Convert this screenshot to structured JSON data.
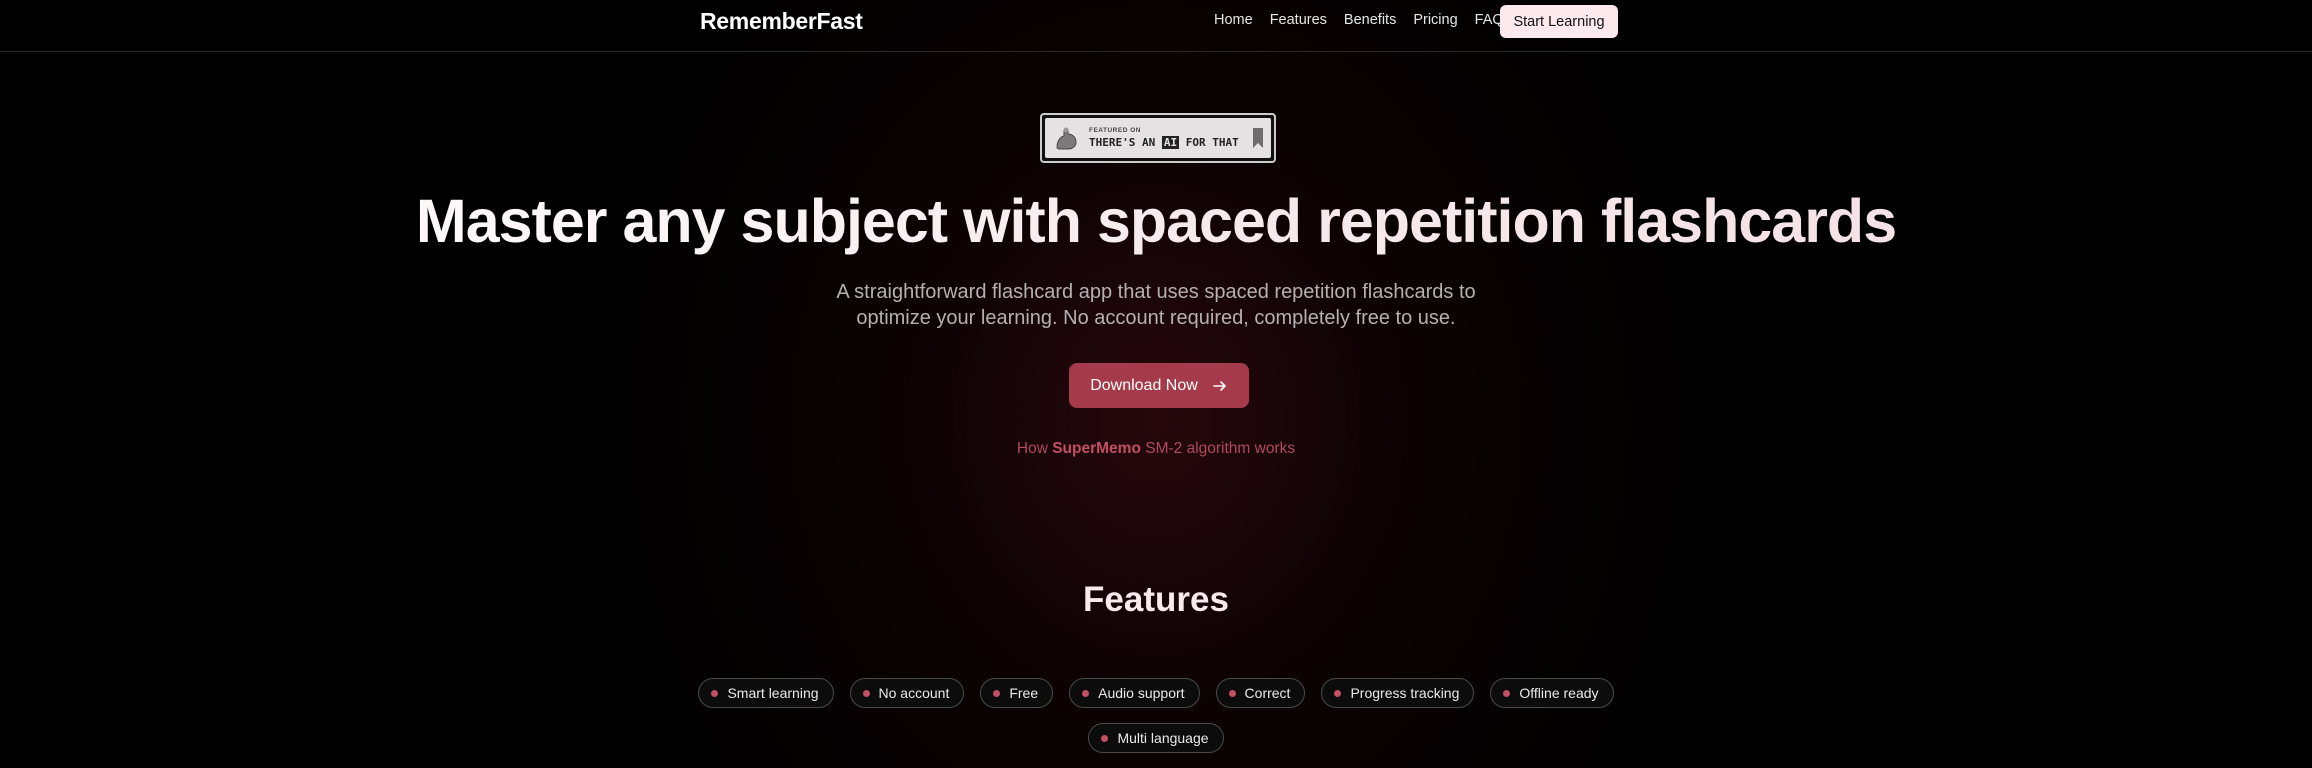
{
  "nav": {
    "brand": "RememberFast",
    "links": [
      "Home",
      "Features",
      "Benefits",
      "Pricing",
      "FAQ"
    ],
    "cta": "Start Learning"
  },
  "badge": {
    "small": "FEATURED ON",
    "big_pre": "THERE'S AN",
    "big_ai": "AI",
    "big_post": "FOR THAT"
  },
  "hero": {
    "title": "Master any subject with spaced repetition flashcards",
    "subtitle": "A straightforward flashcard app that uses spaced repetition flashcards to optimize your learning. No account required, completely free to use.",
    "download_label": "Download Now",
    "how_prefix": "How",
    "how_bold": "SuperMemo",
    "how_suffix": "SM-2 algorithm works"
  },
  "features": {
    "title": "Features",
    "tags": [
      "Smart learning",
      "No account",
      "Free",
      "Audio support",
      "Correct",
      "Progress tracking",
      "Offline ready",
      "Multi language"
    ]
  },
  "colors": {
    "accent": "#a53a4a",
    "accent_text": "#c24f63",
    "cta_bg": "#fbe9ee"
  },
  "icons": {
    "download_arrow": "arrow-right-icon",
    "badge_mascot": "flexed-arm-icon",
    "badge_bookmark": "bookmark-icon",
    "tag_bullet": "dot-icon"
  }
}
